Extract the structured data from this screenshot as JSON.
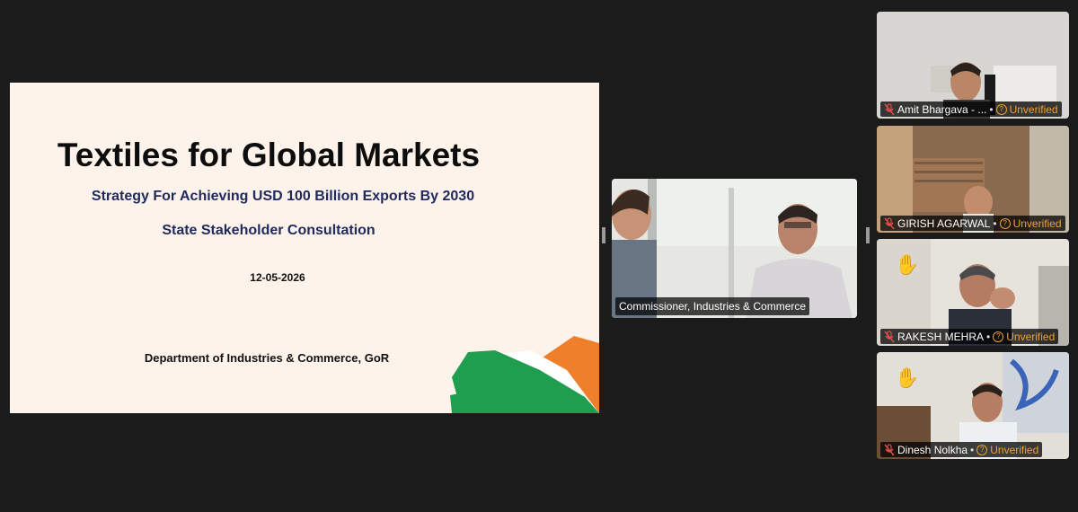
{
  "slide": {
    "title": "Textiles for Global Markets",
    "subtitle": "Strategy For Achieving USD 100 Billion Exports By 2030",
    "subtitle2": "State Stakeholder Consultation",
    "date": "12-05-2026",
    "department": "Department of Industries & Commerce, GoR",
    "colors": {
      "saffron": "#f07f2c",
      "white": "#ffffff",
      "green": "#1f9e4f"
    }
  },
  "main_participant": {
    "name": "Commissioner, Industries & Commerce"
  },
  "gallery": [
    {
      "name": "Amit Bhargava - ...",
      "status": "Unverified",
      "muted": true,
      "hand_raised": false
    },
    {
      "name": "GIRISH AGARWAL",
      "status": "Unverified",
      "muted": true,
      "hand_raised": false
    },
    {
      "name": "RAKESH MEHRA",
      "status": "Unverified",
      "muted": true,
      "hand_raised": true
    },
    {
      "name": "Dinesh Nolkha",
      "status": "Unverified",
      "muted": true,
      "hand_raised": true
    }
  ]
}
